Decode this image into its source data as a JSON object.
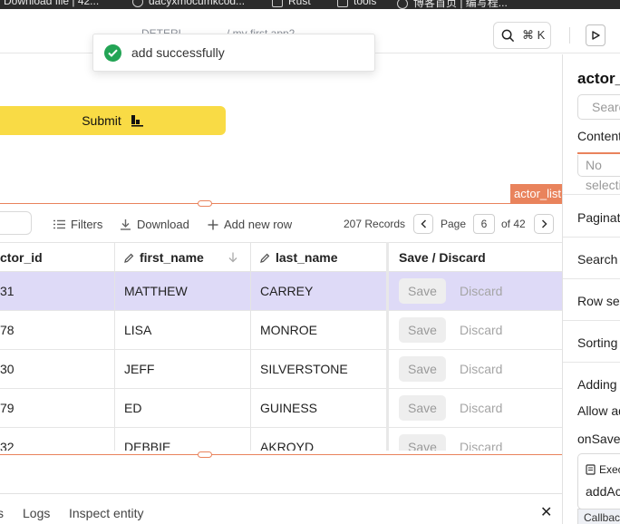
{
  "browser": {
    "bookmarks": [
      "Download file | 42...",
      "dacyxmocumkcod...",
      "Rust",
      "tools",
      "博客首页 | 编写程..."
    ]
  },
  "header": {
    "crumb_left": "DETERL",
    "crumb_app": "/ my first app2",
    "crumb_caret": "⌄",
    "search_shortcut": "⌘ K"
  },
  "toast": {
    "message": "add successfully",
    "color": "#23a455"
  },
  "canvas": {
    "submit_label": "Submit",
    "component_tag": "actor_list",
    "accent": "#e9835c",
    "button_color": "#f9db45"
  },
  "table_toolbar": {
    "filters_label": "Filters",
    "download_label": "Download",
    "add_row_label": "Add new row",
    "records_label": "207 Records",
    "page_label": "Page",
    "page_value": "6",
    "page_of": "of 42"
  },
  "table": {
    "columns": [
      "ctor_id",
      "first_name",
      "last_name",
      "Save / Discard"
    ],
    "save_label": "Save",
    "discard_label": "Discard",
    "rows": [
      {
        "id": "31",
        "first_name": "MATTHEW",
        "last_name": "CARREY",
        "selected": true
      },
      {
        "id": "78",
        "first_name": "LISA",
        "last_name": "MONROE",
        "selected": false
      },
      {
        "id": "30",
        "first_name": "JEFF",
        "last_name": "SILVERSTONE",
        "selected": false
      },
      {
        "id": "79",
        "first_name": "ED",
        "last_name": "GUINESS",
        "selected": false
      },
      {
        "id": "32",
        "first_name": "DEBBIE",
        "last_name": "AKROYD",
        "selected": false
      }
    ],
    "selected_color": "#dedaf7"
  },
  "bottom_bar": {
    "tab_first": "s",
    "logs_label": "Logs",
    "inspect_label": "Inspect entity",
    "close_label": "✕"
  },
  "right_panel": {
    "title": "actor_list",
    "search_placeholder": "Search",
    "content_tab": "Content",
    "select_placeholder": "No selection",
    "items": [
      "Pagination",
      "Search",
      "Row selection",
      "Sorting",
      "Adding",
      "Allow adding",
      "onSave"
    ],
    "exec_label": "Execute",
    "exec_fn": "addActor",
    "callback_label": "Callback"
  }
}
